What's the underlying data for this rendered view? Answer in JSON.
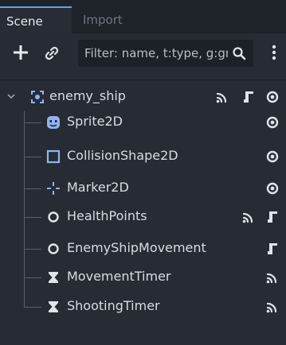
{
  "tabs": [
    {
      "label": "Scene",
      "active": true
    },
    {
      "label": "Import",
      "active": false
    }
  ],
  "toolbar": {
    "filter_placeholder": "Filter: name, t:type, g:group"
  },
  "tree": {
    "root": {
      "label": "enemy_ship"
    },
    "children": [
      {
        "label": "Sprite2D"
      },
      {
        "label": "CollisionShape2D"
      },
      {
        "label": "Marker2D"
      },
      {
        "label": "HealthPoints"
      },
      {
        "label": "EnemyShipMovement"
      },
      {
        "label": "MovementTimer"
      },
      {
        "label": "ShootingTimer"
      }
    ]
  },
  "colors": {
    "accent": "#6aa2e8",
    "node2d": "#8fb4f3",
    "icon_light": "#e0e3e8"
  }
}
